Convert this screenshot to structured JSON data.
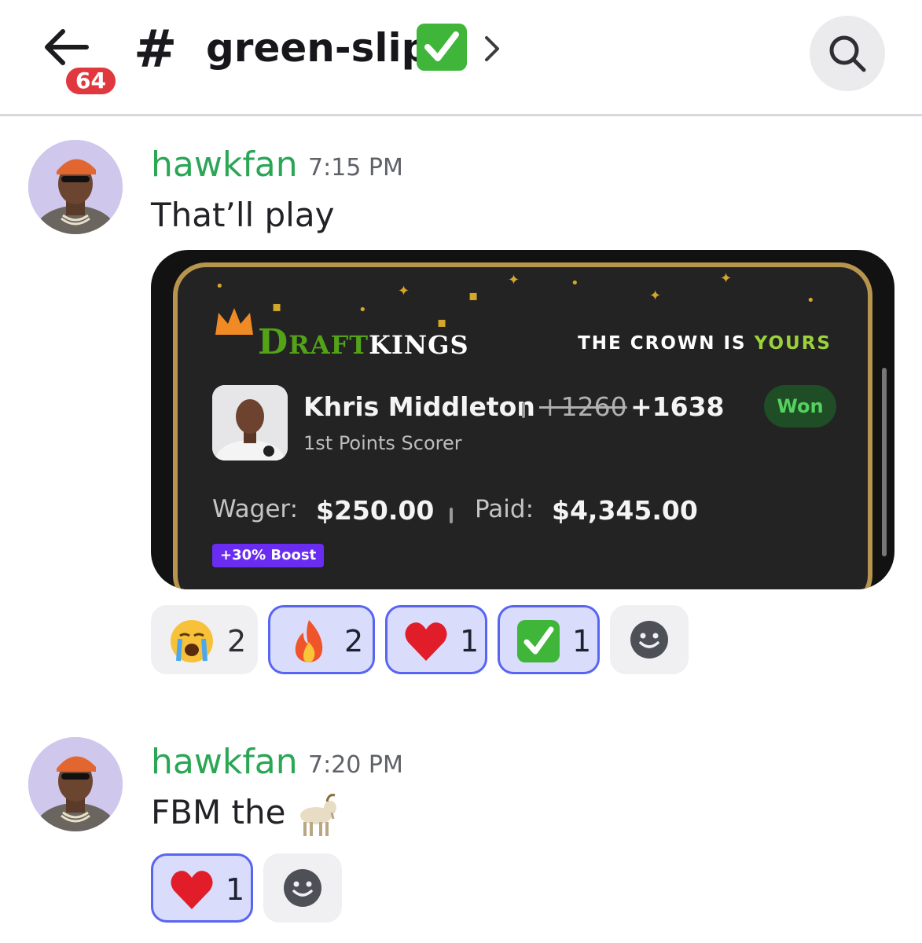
{
  "header": {
    "unread_count": "64",
    "channel_prefix": "#",
    "channel_name": "green-slips",
    "channel_emoji": "check-mark-button-icon"
  },
  "messages": [
    {
      "username": "hawkfan",
      "timestamp": "7:15 PM",
      "text": "That’ll play",
      "reactions": [
        {
          "emoji": "loudly-crying-face-icon",
          "count": "2",
          "active": false
        },
        {
          "emoji": "fire-icon",
          "count": "2",
          "active": true
        },
        {
          "emoji": "red-heart-icon",
          "count": "1",
          "active": true
        },
        {
          "emoji": "check-mark-button-icon",
          "count": "1",
          "active": true
        }
      ]
    },
    {
      "username": "hawkfan",
      "timestamp": "7:20 PM",
      "text": "FBM the",
      "text_emoji": "goat-icon",
      "reactions": [
        {
          "emoji": "red-heart-icon",
          "count": "1",
          "active": true
        }
      ]
    }
  ],
  "bet_slip": {
    "brand_first": "D",
    "brand_green": "RAFT",
    "brand_white": "KINGS",
    "tagline_prefix": "THE CROWN IS",
    "tagline_highlight": "YOURS",
    "player": "Khris Middleton",
    "odds_original": "+1260",
    "odds_boosted": "+1638",
    "status": "Won",
    "market": "1st Points Scorer",
    "wager_label": "Wager:",
    "wager_value": "$250.00",
    "paid_label": "Paid:",
    "paid_value": "$4,345.00",
    "boost": "+30% Boost"
  },
  "colors": {
    "username": "#2aa655",
    "badge": "#e0383e",
    "reaction_active_bg": "#d9dcfb",
    "reaction_active_border": "#5865f2",
    "dk_green": "#53a318",
    "won_green": "#54d15e",
    "boost_purple": "#6a2cf0"
  }
}
